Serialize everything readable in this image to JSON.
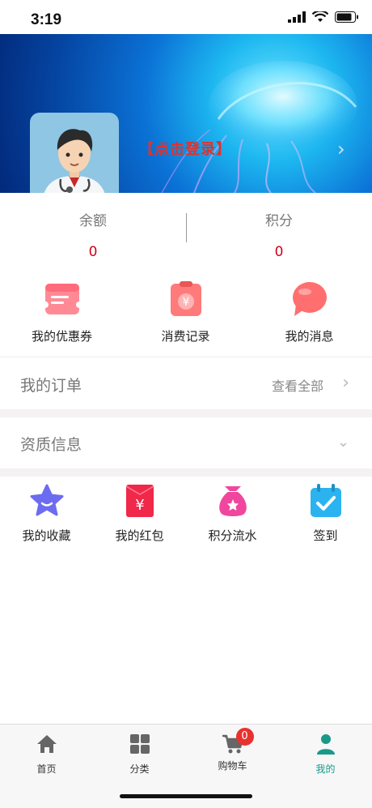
{
  "status_bar": {
    "time": "3:19"
  },
  "header": {
    "login_text": "【点击登录】"
  },
  "stats": [
    {
      "label": "余额",
      "value": "0"
    },
    {
      "label": "积分",
      "value": "0"
    }
  ],
  "quick_actions": [
    {
      "label": "我的优惠券",
      "icon": "coupon-icon"
    },
    {
      "label": "消费记录",
      "icon": "bill-icon"
    },
    {
      "label": "我的消息",
      "icon": "message-icon"
    }
  ],
  "orders": {
    "title": "我的订单",
    "view_all": "查看全部"
  },
  "qualification": {
    "title": "资质信息"
  },
  "features": [
    {
      "label": "我的收藏",
      "icon": "star-icon"
    },
    {
      "label": "我的红包",
      "icon": "red-envelope-icon"
    },
    {
      "label": "积分流水",
      "icon": "money-bag-icon"
    },
    {
      "label": "签到",
      "icon": "calendar-check-icon"
    }
  ],
  "tabbar": {
    "items": [
      {
        "label": "首页",
        "icon": "home-icon"
      },
      {
        "label": "分类",
        "icon": "grid-icon"
      },
      {
        "label": "购物车",
        "icon": "cart-icon",
        "badge": "0"
      },
      {
        "label": "我的",
        "icon": "user-icon",
        "active": true
      }
    ]
  },
  "colors": {
    "accent": "#19998a",
    "price": "#d0021b",
    "badge": "#e8322e"
  }
}
